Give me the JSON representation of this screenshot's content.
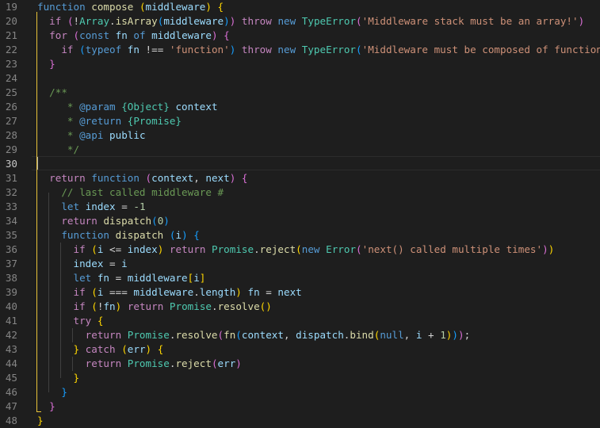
{
  "editor": {
    "line_numbers": [
      "19",
      "20",
      "21",
      "22",
      "23",
      "24",
      "25",
      "26",
      "27",
      "28",
      "29",
      "30",
      "31",
      "32",
      "33",
      "34",
      "35",
      "36",
      "37",
      "38",
      "39",
      "40",
      "41",
      "42",
      "43",
      "44",
      "45",
      "46",
      "47",
      "48"
    ],
    "active_line": "30",
    "lines": [
      [
        [
          "kw",
          "function"
        ],
        [
          "pl",
          " "
        ],
        [
          "fn",
          "compose"
        ],
        [
          "pl",
          " "
        ],
        [
          "b1",
          "("
        ],
        [
          "var",
          "middleware"
        ],
        [
          "b1",
          ")"
        ],
        [
          "pl",
          " "
        ],
        [
          "b1",
          "{"
        ]
      ],
      [
        [
          "pl",
          "  "
        ],
        [
          "ctl",
          "if"
        ],
        [
          "pl",
          " "
        ],
        [
          "b2",
          "("
        ],
        [
          "pl",
          "!"
        ],
        [
          "cls",
          "Array"
        ],
        [
          "pl",
          "."
        ],
        [
          "fn",
          "isArray"
        ],
        [
          "b3",
          "("
        ],
        [
          "var",
          "middleware"
        ],
        [
          "b3",
          ")"
        ],
        [
          "b2",
          ")"
        ],
        [
          "pl",
          " "
        ],
        [
          "ctl",
          "throw"
        ],
        [
          "pl",
          " "
        ],
        [
          "kw",
          "new"
        ],
        [
          "pl",
          " "
        ],
        [
          "cls",
          "TypeError"
        ],
        [
          "b2",
          "("
        ],
        [
          "str",
          "'Middleware stack must be an array!'"
        ],
        [
          "b2",
          ")"
        ]
      ],
      [
        [
          "pl",
          "  "
        ],
        [
          "ctl",
          "for"
        ],
        [
          "pl",
          " "
        ],
        [
          "b2",
          "("
        ],
        [
          "kw",
          "const"
        ],
        [
          "pl",
          " "
        ],
        [
          "var",
          "fn"
        ],
        [
          "pl",
          " "
        ],
        [
          "kw",
          "of"
        ],
        [
          "pl",
          " "
        ],
        [
          "var",
          "middleware"
        ],
        [
          "b2",
          ")"
        ],
        [
          "pl",
          " "
        ],
        [
          "b2",
          "{"
        ]
      ],
      [
        [
          "pl",
          "    "
        ],
        [
          "ctl",
          "if"
        ],
        [
          "pl",
          " "
        ],
        [
          "b3",
          "("
        ],
        [
          "kw",
          "typeof"
        ],
        [
          "pl",
          " "
        ],
        [
          "var",
          "fn"
        ],
        [
          "pl",
          " !== "
        ],
        [
          "str",
          "'function'"
        ],
        [
          "b3",
          ")"
        ],
        [
          "pl",
          " "
        ],
        [
          "ctl",
          "throw"
        ],
        [
          "pl",
          " "
        ],
        [
          "kw",
          "new"
        ],
        [
          "pl",
          " "
        ],
        [
          "cls",
          "TypeError"
        ],
        [
          "b3",
          "("
        ],
        [
          "str",
          "'Middleware must be composed of functions!'"
        ],
        [
          "b3",
          ")"
        ]
      ],
      [
        [
          "pl",
          "  "
        ],
        [
          "b2",
          "}"
        ]
      ],
      [],
      [
        [
          "pl",
          "  "
        ],
        [
          "cmt",
          "/**"
        ]
      ],
      [
        [
          "pl",
          "  "
        ],
        [
          "cmt",
          "   * "
        ],
        [
          "kw",
          "@param"
        ],
        [
          "cmt",
          " "
        ],
        [
          "cls",
          "{Object}"
        ],
        [
          "cmt",
          " "
        ],
        [
          "var",
          "context"
        ]
      ],
      [
        [
          "pl",
          "  "
        ],
        [
          "cmt",
          "   * "
        ],
        [
          "kw",
          "@return"
        ],
        [
          "cmt",
          " "
        ],
        [
          "cls",
          "{Promise}"
        ]
      ],
      [
        [
          "pl",
          "  "
        ],
        [
          "cmt",
          "   * "
        ],
        [
          "kw",
          "@api"
        ],
        [
          "cmt",
          " "
        ],
        [
          "var",
          "public"
        ]
      ],
      [
        [
          "pl",
          "  "
        ],
        [
          "cmt",
          "   */"
        ]
      ],
      [],
      [
        [
          "pl",
          "  "
        ],
        [
          "ctl",
          "return"
        ],
        [
          "pl",
          " "
        ],
        [
          "kw",
          "function"
        ],
        [
          "pl",
          " "
        ],
        [
          "b2",
          "("
        ],
        [
          "var",
          "context"
        ],
        [
          "pl",
          ", "
        ],
        [
          "var",
          "next"
        ],
        [
          "b2",
          ")"
        ],
        [
          "pl",
          " "
        ],
        [
          "b2",
          "{"
        ]
      ],
      [
        [
          "pl",
          "    "
        ],
        [
          "cmt",
          "// last called middleware #"
        ]
      ],
      [
        [
          "pl",
          "    "
        ],
        [
          "kw",
          "let"
        ],
        [
          "pl",
          " "
        ],
        [
          "var",
          "index"
        ],
        [
          "pl",
          " = "
        ],
        [
          "num",
          "-1"
        ]
      ],
      [
        [
          "pl",
          "    "
        ],
        [
          "ctl",
          "return"
        ],
        [
          "pl",
          " "
        ],
        [
          "fn",
          "dispatch"
        ],
        [
          "b3",
          "("
        ],
        [
          "num",
          "0"
        ],
        [
          "b3",
          ")"
        ]
      ],
      [
        [
          "pl",
          "    "
        ],
        [
          "kw",
          "function"
        ],
        [
          "pl",
          " "
        ],
        [
          "fn",
          "dispatch"
        ],
        [
          "pl",
          " "
        ],
        [
          "b3",
          "("
        ],
        [
          "var",
          "i"
        ],
        [
          "b3",
          ")"
        ],
        [
          "pl",
          " "
        ],
        [
          "b3",
          "{"
        ]
      ],
      [
        [
          "pl",
          "      "
        ],
        [
          "ctl",
          "if"
        ],
        [
          "pl",
          " "
        ],
        [
          "b1",
          "("
        ],
        [
          "var",
          "i"
        ],
        [
          "pl",
          " <= "
        ],
        [
          "var",
          "index"
        ],
        [
          "b1",
          ")"
        ],
        [
          "pl",
          " "
        ],
        [
          "ctl",
          "return"
        ],
        [
          "pl",
          " "
        ],
        [
          "cls",
          "Promise"
        ],
        [
          "pl",
          "."
        ],
        [
          "fn",
          "reject"
        ],
        [
          "b1",
          "("
        ],
        [
          "kw",
          "new"
        ],
        [
          "pl",
          " "
        ],
        [
          "cls",
          "Error"
        ],
        [
          "b2",
          "("
        ],
        [
          "str",
          "'next() called multiple times'"
        ],
        [
          "b2",
          ")"
        ],
        [
          "b1",
          ")"
        ]
      ],
      [
        [
          "pl",
          "      "
        ],
        [
          "var",
          "index"
        ],
        [
          "pl",
          " = "
        ],
        [
          "var",
          "i"
        ]
      ],
      [
        [
          "pl",
          "      "
        ],
        [
          "kw",
          "let"
        ],
        [
          "pl",
          " "
        ],
        [
          "var",
          "fn"
        ],
        [
          "pl",
          " = "
        ],
        [
          "var",
          "middleware"
        ],
        [
          "b1",
          "["
        ],
        [
          "var",
          "i"
        ],
        [
          "b1",
          "]"
        ]
      ],
      [
        [
          "pl",
          "      "
        ],
        [
          "ctl",
          "if"
        ],
        [
          "pl",
          " "
        ],
        [
          "b1",
          "("
        ],
        [
          "var",
          "i"
        ],
        [
          "pl",
          " === "
        ],
        [
          "var",
          "middleware"
        ],
        [
          "pl",
          "."
        ],
        [
          "var",
          "length"
        ],
        [
          "b1",
          ")"
        ],
        [
          "pl",
          " "
        ],
        [
          "var",
          "fn"
        ],
        [
          "pl",
          " = "
        ],
        [
          "var",
          "next"
        ]
      ],
      [
        [
          "pl",
          "      "
        ],
        [
          "ctl",
          "if"
        ],
        [
          "pl",
          " "
        ],
        [
          "b1",
          "("
        ],
        [
          "pl",
          "!"
        ],
        [
          "var",
          "fn"
        ],
        [
          "b1",
          ")"
        ],
        [
          "pl",
          " "
        ],
        [
          "ctl",
          "return"
        ],
        [
          "pl",
          " "
        ],
        [
          "cls",
          "Promise"
        ],
        [
          "pl",
          "."
        ],
        [
          "fn",
          "resolve"
        ],
        [
          "b1",
          "("
        ],
        [
          "b1",
          ")"
        ]
      ],
      [
        [
          "pl",
          "      "
        ],
        [
          "ctl",
          "try"
        ],
        [
          "pl",
          " "
        ],
        [
          "b1",
          "{"
        ]
      ],
      [
        [
          "pl",
          "        "
        ],
        [
          "ctl",
          "return"
        ],
        [
          "pl",
          " "
        ],
        [
          "cls",
          "Promise"
        ],
        [
          "pl",
          "."
        ],
        [
          "fn",
          "resolve"
        ],
        [
          "b2",
          "("
        ],
        [
          "fn",
          "fn"
        ],
        [
          "b3",
          "("
        ],
        [
          "var",
          "context"
        ],
        [
          "pl",
          ", "
        ],
        [
          "var",
          "dispatch"
        ],
        [
          "pl",
          "."
        ],
        [
          "fn",
          "bind"
        ],
        [
          "b1",
          "("
        ],
        [
          "kw",
          "null"
        ],
        [
          "pl",
          ", "
        ],
        [
          "var",
          "i"
        ],
        [
          "pl",
          " + "
        ],
        [
          "num",
          "1"
        ],
        [
          "b1",
          ")"
        ],
        [
          "b3",
          ")"
        ],
        [
          "b2",
          ")"
        ],
        [
          "pl",
          ";"
        ]
      ],
      [
        [
          "pl",
          "      "
        ],
        [
          "b1",
          "}"
        ],
        [
          "pl",
          " "
        ],
        [
          "ctl",
          "catch"
        ],
        [
          "pl",
          " "
        ],
        [
          "b1",
          "("
        ],
        [
          "var",
          "err"
        ],
        [
          "b1",
          ")"
        ],
        [
          "pl",
          " "
        ],
        [
          "b1",
          "{"
        ]
      ],
      [
        [
          "pl",
          "        "
        ],
        [
          "ctl",
          "return"
        ],
        [
          "pl",
          " "
        ],
        [
          "cls",
          "Promise"
        ],
        [
          "pl",
          "."
        ],
        [
          "fn",
          "reject"
        ],
        [
          "b2",
          "("
        ],
        [
          "var",
          "err"
        ],
        [
          "b2",
          ")"
        ]
      ],
      [
        [
          "pl",
          "      "
        ],
        [
          "b1",
          "}"
        ]
      ],
      [
        [
          "pl",
          "    "
        ],
        [
          "b3",
          "}"
        ]
      ],
      [
        [
          "pl",
          "  "
        ],
        [
          "b2",
          "}"
        ]
      ],
      [
        [
          "b1",
          "}"
        ]
      ]
    ]
  }
}
